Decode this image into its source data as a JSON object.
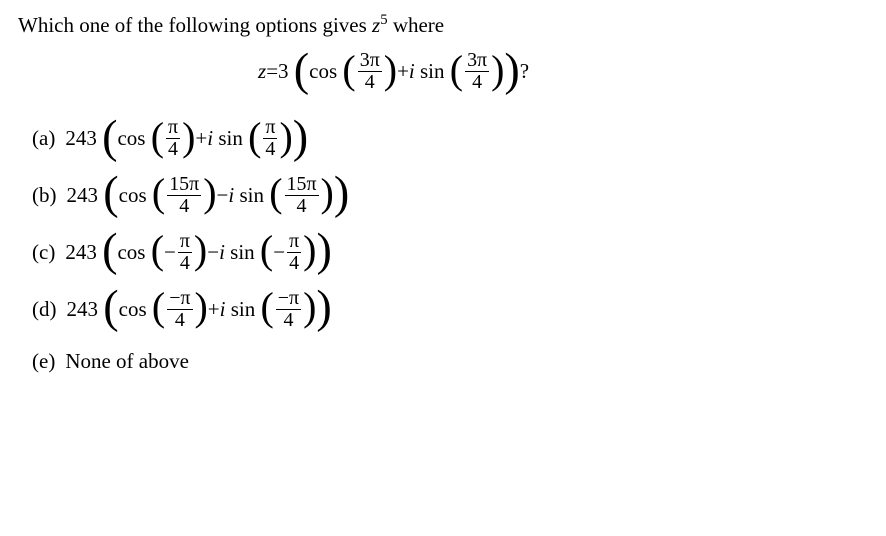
{
  "question": {
    "prompt_prefix": "Which one of the following options gives ",
    "z_var": "z",
    "z_exp": "5",
    "prompt_suffix": " where",
    "eq_lhs_var": "z",
    "eq_equals": " = ",
    "eq_coeff": "3",
    "eq_cos": "cos",
    "eq_sin": "sin",
    "eq_plus_i": " + ",
    "eq_i": "i",
    "eq_frac_num": "3π",
    "eq_frac_den": "4",
    "eq_qmark": " ?"
  },
  "options": {
    "a": {
      "label": "(a)",
      "coeff": "243",
      "cos": "cos",
      "sin": "sin",
      "join": " + ",
      "i": "i",
      "frac1_num": "π",
      "frac1_den": "4",
      "frac2_num": "π",
      "frac2_den": "4",
      "neg1": "",
      "neg2": ""
    },
    "b": {
      "label": "(b)",
      "coeff": "243",
      "cos": "cos",
      "sin": "sin",
      "join": " − ",
      "i": "i",
      "frac1_num": "15π",
      "frac1_den": "4",
      "frac2_num": "15π",
      "frac2_den": "4",
      "neg1": "",
      "neg2": ""
    },
    "c": {
      "label": "(c)",
      "coeff": "243",
      "cos": "cos",
      "sin": "sin",
      "join": " − ",
      "i": "i",
      "frac1_num": "π",
      "frac1_den": "4",
      "frac2_num": "π",
      "frac2_den": "4",
      "neg1": "−",
      "neg2": "−"
    },
    "d": {
      "label": "(d)",
      "coeff": "243",
      "cos": "cos",
      "sin": "sin",
      "join": " + ",
      "i": "i",
      "frac1_num": "−π",
      "frac1_den": "4",
      "frac2_num": "−π",
      "frac2_den": "4",
      "neg1": "",
      "neg2": ""
    },
    "e": {
      "label": "(e)",
      "text": "None of above"
    }
  }
}
